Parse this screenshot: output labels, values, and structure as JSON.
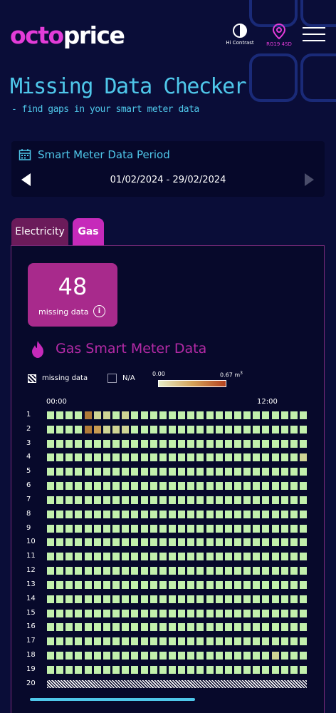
{
  "header": {
    "logo_part1": "octo",
    "logo_part2": "price",
    "hi_contrast_label": "Hi Contrast",
    "location_label": "RG19 4SD"
  },
  "page": {
    "title": "Missing Data Checker",
    "subtitle": "- find gaps in your smart meter data"
  },
  "period": {
    "title": "Smart Meter Data Period",
    "range": "01/02/2024 - 29/02/2024"
  },
  "tabs": [
    {
      "label": "Electricity",
      "active": false
    },
    {
      "label": "Gas",
      "active": true
    }
  ],
  "summary": {
    "missing_count": "48",
    "missing_label": "missing data"
  },
  "section": {
    "title": "Gas Smart Meter Data"
  },
  "legend": {
    "missing_label": "missing data",
    "na_label": "N/A",
    "scale_min": "0.00",
    "scale_max": "0.67",
    "scale_unit": "m",
    "scale_unit_sup": "3"
  },
  "colors": {
    "accent_pink": "#e33cd8",
    "accent_cyan": "#4fc7ea",
    "cell_low": "#c2f0ac",
    "cell_mid": "#d4a35a",
    "cell_high": "#b5431f"
  },
  "grid": {
    "time_labels": [
      "00:00",
      "12:00"
    ],
    "rows": [
      {
        "label": "1",
        "missing": false
      },
      {
        "label": "2",
        "missing": false
      },
      {
        "label": "3",
        "missing": false
      },
      {
        "label": "4",
        "missing": false
      },
      {
        "label": "5",
        "missing": false
      },
      {
        "label": "6",
        "missing": false
      },
      {
        "label": "7",
        "missing": false
      },
      {
        "label": "8",
        "missing": false
      },
      {
        "label": "9",
        "missing": false
      },
      {
        "label": "10",
        "missing": false
      },
      {
        "label": "11",
        "missing": false
      },
      {
        "label": "12",
        "missing": false
      },
      {
        "label": "13",
        "missing": false
      },
      {
        "label": "14",
        "missing": false
      },
      {
        "label": "15",
        "missing": false
      },
      {
        "label": "16",
        "missing": false
      },
      {
        "label": "17",
        "missing": false
      },
      {
        "label": "18",
        "missing": false
      },
      {
        "label": "19",
        "missing": false
      },
      {
        "label": "20",
        "missing": true
      }
    ],
    "highlight_cells": [
      {
        "row": 0,
        "col": 4,
        "level": "high"
      },
      {
        "row": 0,
        "col": 5,
        "level": "low-mid"
      },
      {
        "row": 0,
        "col": 6,
        "level": "low-mid"
      },
      {
        "row": 0,
        "col": 8,
        "level": "low-mid"
      },
      {
        "row": 1,
        "col": 4,
        "level": "high"
      },
      {
        "row": 1,
        "col": 5,
        "level": "mid"
      },
      {
        "row": 1,
        "col": 6,
        "level": "low-mid"
      },
      {
        "row": 1,
        "col": 7,
        "level": "low-mid"
      },
      {
        "row": 1,
        "col": 8,
        "level": "low-mid"
      },
      {
        "row": 3,
        "col": 27,
        "level": "low-mid"
      },
      {
        "row": 17,
        "col": 24,
        "level": "low-mid"
      }
    ]
  }
}
